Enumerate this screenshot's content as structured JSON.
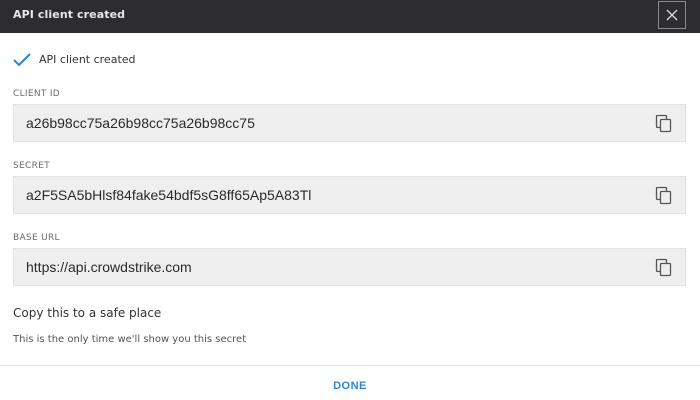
{
  "dialog": {
    "title": "API client created",
    "close_icon": "close-icon"
  },
  "status": {
    "icon": "checkmark-icon",
    "text": "API client created",
    "color": "#2b87c8"
  },
  "fields": [
    {
      "label": "CLIENT ID",
      "value": "a26b98cc75a26b98cc75a26b98cc75",
      "icon": "copy-icon"
    },
    {
      "label": "SECRET",
      "value": "a2F5SA5bHlsf84fake54bdf5sG8ff65Ap5A83Tl",
      "icon": "copy-icon"
    },
    {
      "label": "BASE URL",
      "value": "https://api.crowdstrike.com",
      "icon": "copy-icon"
    }
  ],
  "notice": {
    "heading": "Copy this to a safe place",
    "text": "This is the only time we'll show you this secret"
  },
  "footer": {
    "done_label": "DONE",
    "accent": "#2b87c8"
  }
}
